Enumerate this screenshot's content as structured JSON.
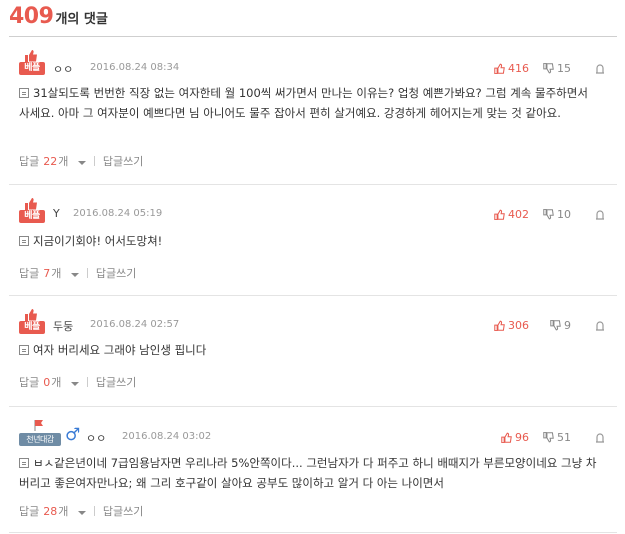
{
  "header": {
    "count": "409",
    "suffix": "개의 댓글"
  },
  "comments": [
    {
      "badge": "베플",
      "author": "ㅇㅇ",
      "date": "2016.08.24 08:34",
      "likes": "416",
      "dislikes": "15",
      "text": "31살되도록 번번한 직장 없는 여자한테 월 100씩 써가면서 만나는 이유는? 업청 예쁜가봐요? 그럼 계속 물주하면서 사세요. 아마 그 여자분이 예쁘다면 님 아니어도 물주 잡아서 편히 살거예요. 강경하게 헤어지는게 맞는 것 같아요.",
      "reply_label": "답글",
      "reply_count": "22",
      "reply_unit": "개",
      "write_reply": "답글쓰기"
    },
    {
      "badge": "베플",
      "author": "Y",
      "date": "2016.08.24 05:19",
      "likes": "402",
      "dislikes": "10",
      "text": "지금이기회야! 어서도망쳐!",
      "reply_label": "답글",
      "reply_count": "7",
      "reply_unit": "개",
      "write_reply": "답글쓰기"
    },
    {
      "badge": "베플",
      "author": "두둥",
      "date": "2016.08.24 02:57",
      "likes": "306",
      "dislikes": "9",
      "text": "여자 버리세요 그래야 남인생 핍니다",
      "reply_label": "답글",
      "reply_count": "0",
      "reply_unit": "개",
      "write_reply": "답글쓰기"
    },
    {
      "badge": "천년대감",
      "author": "ㅇㅇ",
      "date": "2016.08.24 03:02",
      "likes": "96",
      "dislikes": "51",
      "text": "ㅂㅅ같은년이네 7급임용남자면 우리나라 5%안쪽이다... 그런남자가 다 퍼주고 하니 배때지가 부른모양이네요 그냥 차버리고 좋은여자만나요; 왜 그리 호구같이 살아요 공부도 많이하고 알거 다 아는 나이면서",
      "reply_label": "답글",
      "reply_count": "28",
      "reply_unit": "개",
      "write_reply": "답글쓰기"
    }
  ],
  "colors": {
    "accent": "#e85a4f",
    "muted": "#888888",
    "rank_badge": "#6f8ca5",
    "male": "#3a7bd5"
  }
}
